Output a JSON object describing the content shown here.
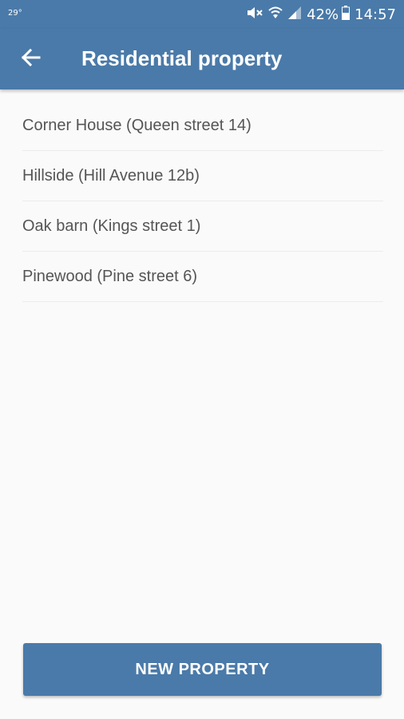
{
  "status_bar": {
    "temperature": "29°",
    "battery_percent": "42%",
    "time": "14:57",
    "icons": [
      "mute-icon",
      "wifi-icon",
      "signal-icon",
      "battery-icon"
    ]
  },
  "app_bar": {
    "title": "Residential property",
    "back_icon": "arrow-back-icon"
  },
  "properties": [
    {
      "label": "Corner House (Queen street 14)"
    },
    {
      "label": "Hillside (Hill Avenue 12b)"
    },
    {
      "label": "Oak barn (Kings street 1)"
    },
    {
      "label": "Pinewood (Pine street 6)"
    }
  ],
  "actions": {
    "new_property_label": "NEW PROPERTY"
  },
  "colors": {
    "primary": "#4a7aa9",
    "background": "#fafafa",
    "list_text": "#555555"
  }
}
